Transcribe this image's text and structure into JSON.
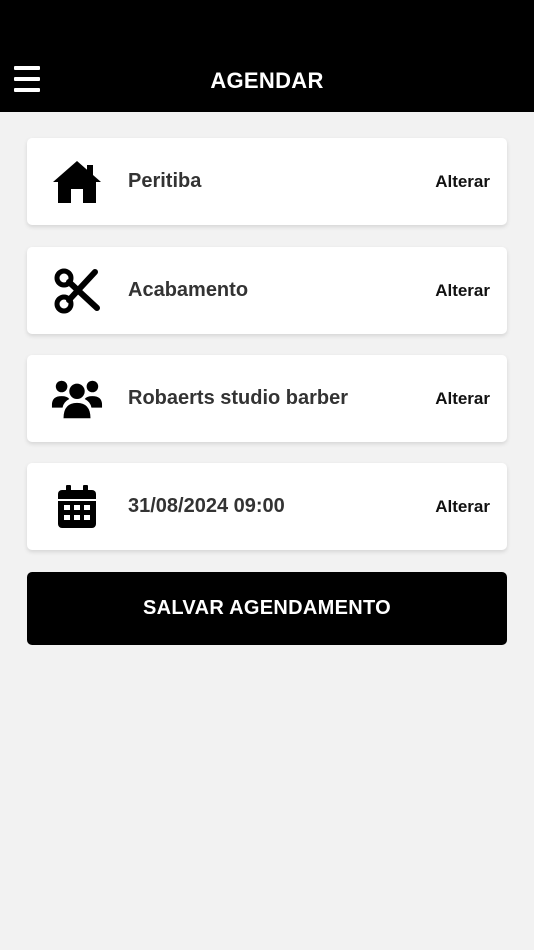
{
  "header": {
    "title": "AGENDAR",
    "menu_icon": "hamburger-menu-icon"
  },
  "items": [
    {
      "icon": "home-icon",
      "label": "Peritiba",
      "action": "Alterar"
    },
    {
      "icon": "scissors-icon",
      "label": "Acabamento",
      "action": "Alterar"
    },
    {
      "icon": "users-icon",
      "label": "Robaerts studio barber",
      "action": "Alterar"
    },
    {
      "icon": "calendar-icon",
      "label": "31/08/2024 09:00",
      "action": "Alterar"
    }
  ],
  "save_button": {
    "label": "SALVAR AGENDAMENTO"
  },
  "colors": {
    "header_bg": "#000000",
    "page_bg": "#f2f2f2",
    "card_bg": "#ffffff",
    "button_bg": "#000000"
  }
}
